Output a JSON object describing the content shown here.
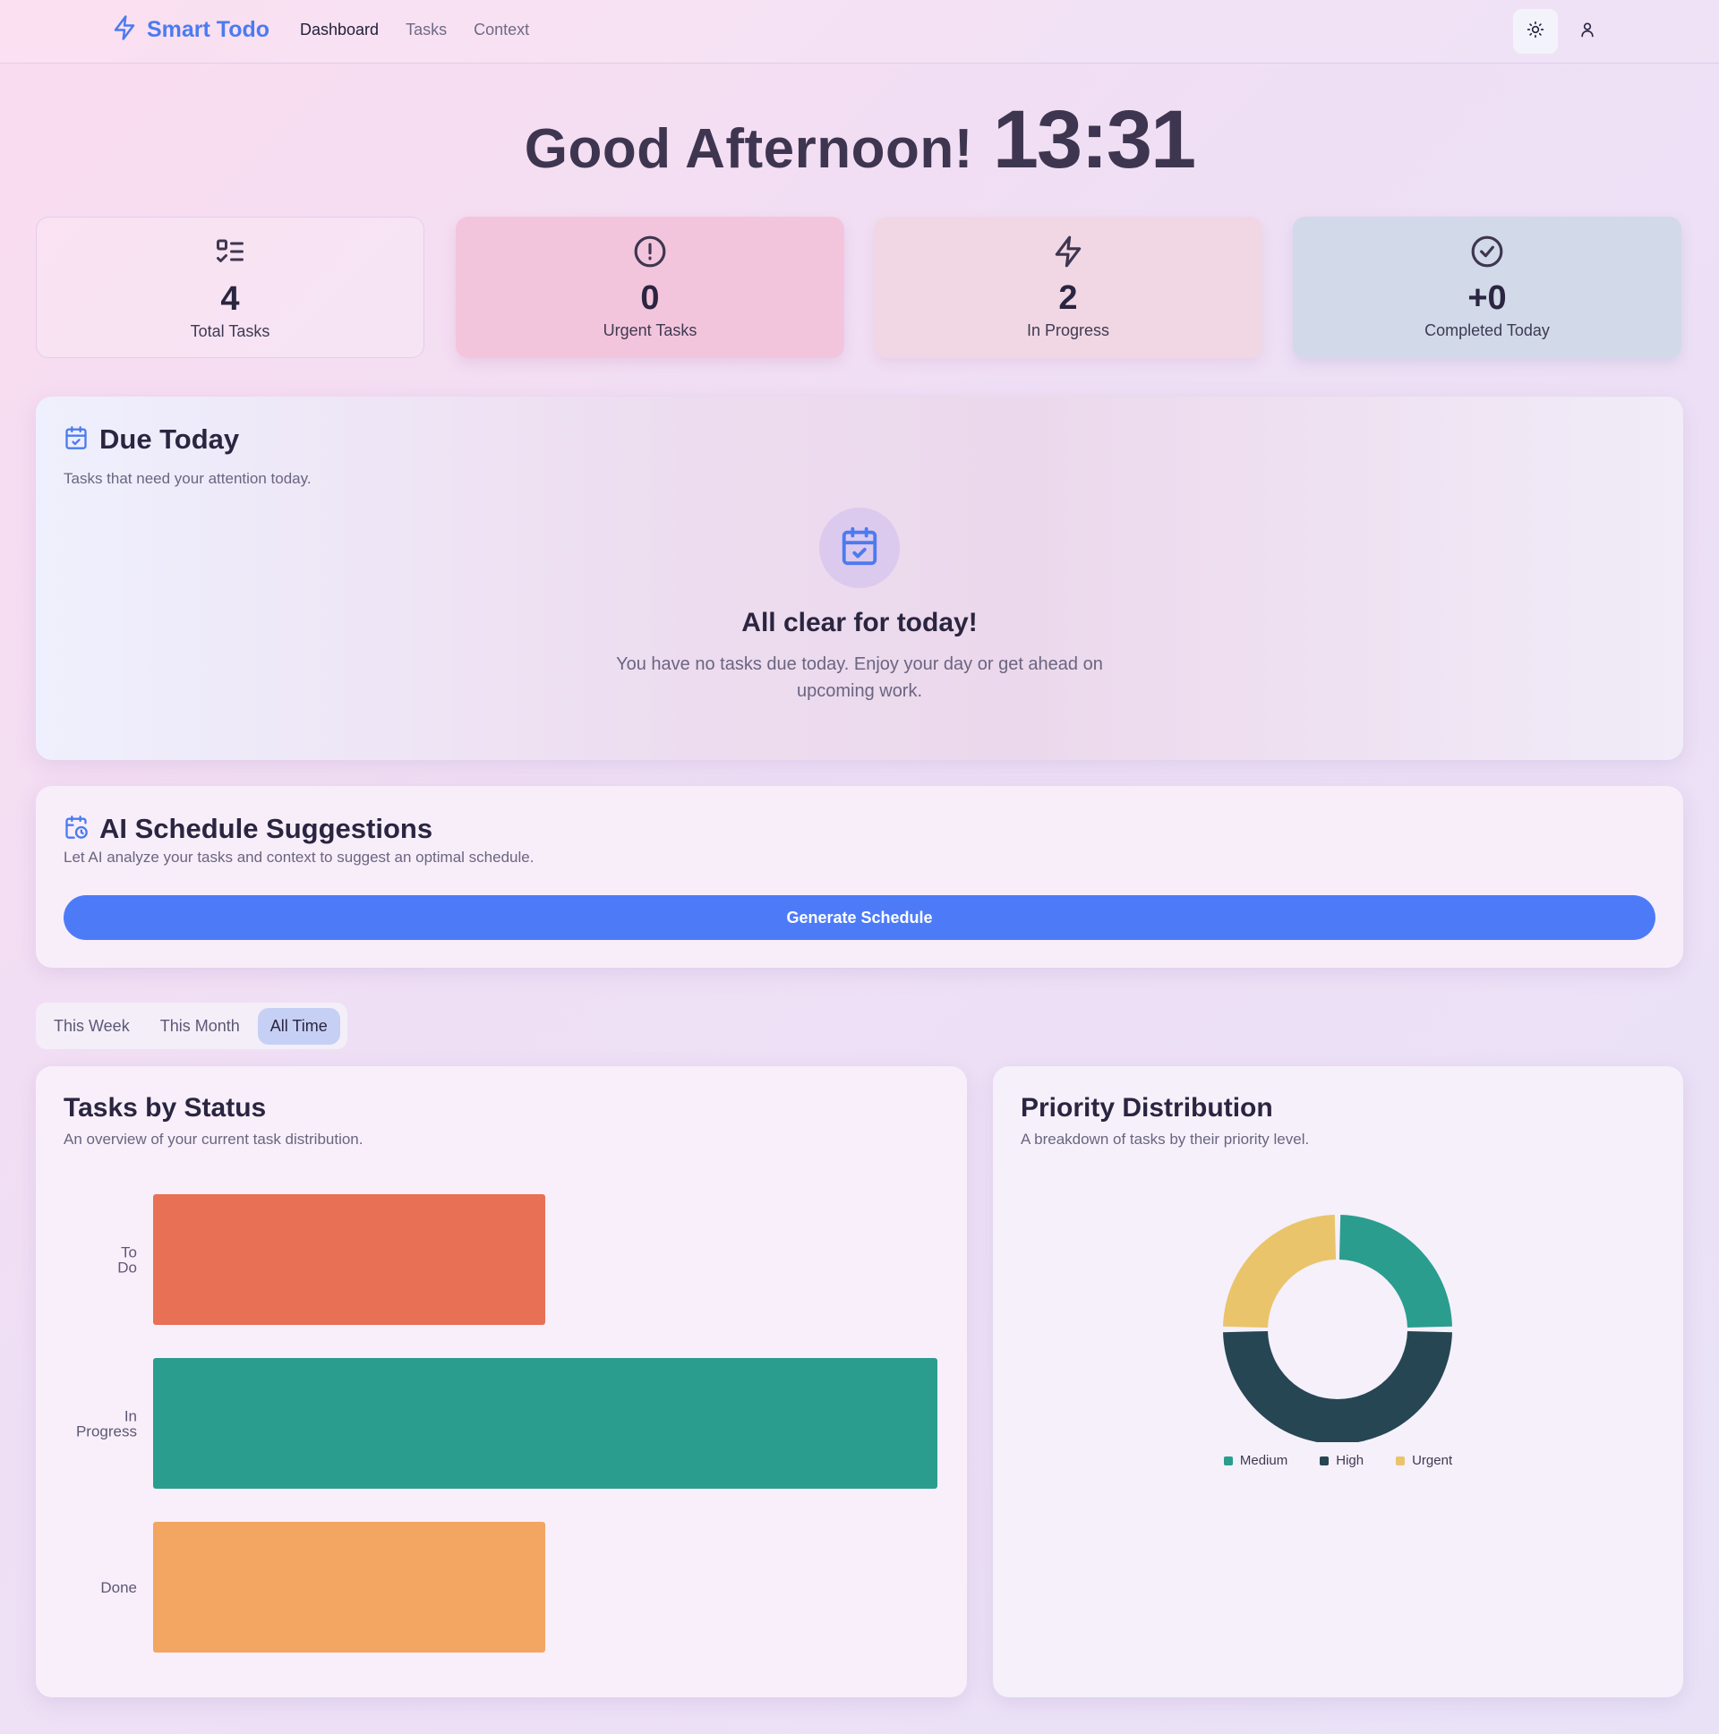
{
  "nav": {
    "brand": "Smart Todo",
    "links": [
      "Dashboard",
      "Tasks",
      "Context"
    ],
    "active": "Dashboard"
  },
  "greeting": {
    "text": "Good Afternoon!",
    "time": "13:31"
  },
  "stats": [
    {
      "value": "4",
      "label": "Total Tasks",
      "icon": "list-check-icon"
    },
    {
      "value": "0",
      "label": "Urgent Tasks",
      "icon": "alert-circle-icon"
    },
    {
      "value": "2",
      "label": "In Progress",
      "icon": "zap-icon"
    },
    {
      "value": "+0",
      "label": "Completed Today",
      "icon": "check-circle-icon"
    }
  ],
  "due_today": {
    "title": "Due Today",
    "subtitle": "Tasks that need your attention today.",
    "empty_title": "All clear for today!",
    "empty_text": "You have no tasks due today. Enjoy your day or get ahead on upcoming work."
  },
  "ai_schedule": {
    "title": "AI Schedule Suggestions",
    "subtitle": "Let AI analyze your tasks and context to suggest an optimal schedule.",
    "button": "Generate Schedule"
  },
  "range_tabs": {
    "items": [
      "This Week",
      "This Month",
      "All Time"
    ],
    "active": "All Time"
  },
  "colors": {
    "accent": "#4d7bf8",
    "todo": "#e87055",
    "in_progress": "#2a9d8f",
    "done": "#f3a562",
    "high": "#264653",
    "urgent": "#e9c46a"
  },
  "status_chart": {
    "title": "Tasks by Status",
    "subtitle": "An overview of your current task distribution."
  },
  "priority_chart": {
    "title": "Priority Distribution",
    "subtitle": "A breakdown of tasks by their priority level."
  },
  "chart_data": [
    {
      "type": "bar",
      "orientation": "horizontal",
      "title": "Tasks by Status",
      "categories": [
        "To Do",
        "In Progress",
        "Done"
      ],
      "values": [
        1,
        2,
        1
      ],
      "colors": [
        "#e87055",
        "#2a9d8f",
        "#f3a562"
      ],
      "xlim": [
        0,
        2
      ]
    },
    {
      "type": "pie",
      "donut": true,
      "title": "Priority Distribution",
      "categories": [
        "Medium",
        "High",
        "Urgent"
      ],
      "values": [
        1,
        2,
        1
      ],
      "colors": [
        "#2a9d8f",
        "#264653",
        "#e9c46a"
      ],
      "legend": "bottom"
    }
  ]
}
